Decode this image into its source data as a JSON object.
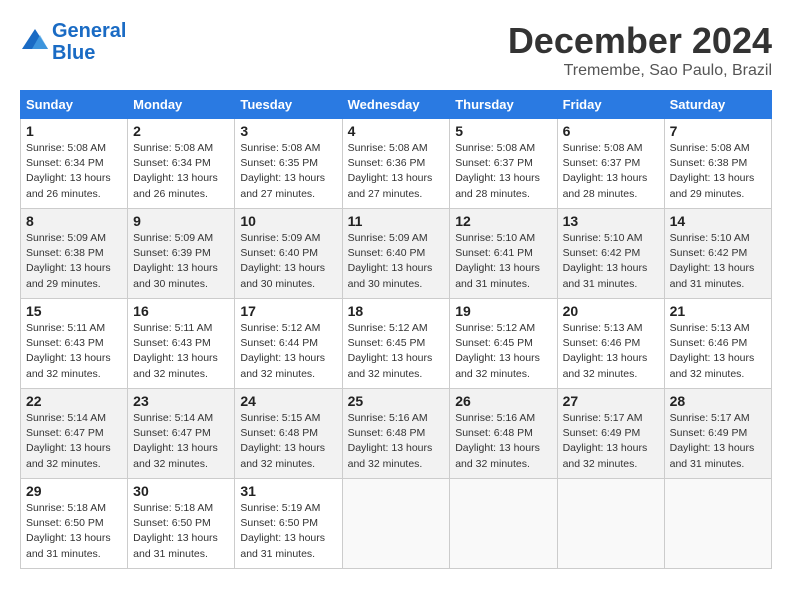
{
  "header": {
    "logo_line1": "General",
    "logo_line2": "Blue",
    "month": "December 2024",
    "location": "Tremembe, Sao Paulo, Brazil"
  },
  "weekdays": [
    "Sunday",
    "Monday",
    "Tuesday",
    "Wednesday",
    "Thursday",
    "Friday",
    "Saturday"
  ],
  "weeks": [
    [
      {
        "day": "1",
        "info": "Sunrise: 5:08 AM\nSunset: 6:34 PM\nDaylight: 13 hours\nand 26 minutes."
      },
      {
        "day": "2",
        "info": "Sunrise: 5:08 AM\nSunset: 6:34 PM\nDaylight: 13 hours\nand 26 minutes."
      },
      {
        "day": "3",
        "info": "Sunrise: 5:08 AM\nSunset: 6:35 PM\nDaylight: 13 hours\nand 27 minutes."
      },
      {
        "day": "4",
        "info": "Sunrise: 5:08 AM\nSunset: 6:36 PM\nDaylight: 13 hours\nand 27 minutes."
      },
      {
        "day": "5",
        "info": "Sunrise: 5:08 AM\nSunset: 6:37 PM\nDaylight: 13 hours\nand 28 minutes."
      },
      {
        "day": "6",
        "info": "Sunrise: 5:08 AM\nSunset: 6:37 PM\nDaylight: 13 hours\nand 28 minutes."
      },
      {
        "day": "7",
        "info": "Sunrise: 5:08 AM\nSunset: 6:38 PM\nDaylight: 13 hours\nand 29 minutes."
      }
    ],
    [
      {
        "day": "8",
        "info": "Sunrise: 5:09 AM\nSunset: 6:38 PM\nDaylight: 13 hours\nand 29 minutes."
      },
      {
        "day": "9",
        "info": "Sunrise: 5:09 AM\nSunset: 6:39 PM\nDaylight: 13 hours\nand 30 minutes."
      },
      {
        "day": "10",
        "info": "Sunrise: 5:09 AM\nSunset: 6:40 PM\nDaylight: 13 hours\nand 30 minutes."
      },
      {
        "day": "11",
        "info": "Sunrise: 5:09 AM\nSunset: 6:40 PM\nDaylight: 13 hours\nand 30 minutes."
      },
      {
        "day": "12",
        "info": "Sunrise: 5:10 AM\nSunset: 6:41 PM\nDaylight: 13 hours\nand 31 minutes."
      },
      {
        "day": "13",
        "info": "Sunrise: 5:10 AM\nSunset: 6:42 PM\nDaylight: 13 hours\nand 31 minutes."
      },
      {
        "day": "14",
        "info": "Sunrise: 5:10 AM\nSunset: 6:42 PM\nDaylight: 13 hours\nand 31 minutes."
      }
    ],
    [
      {
        "day": "15",
        "info": "Sunrise: 5:11 AM\nSunset: 6:43 PM\nDaylight: 13 hours\nand 32 minutes."
      },
      {
        "day": "16",
        "info": "Sunrise: 5:11 AM\nSunset: 6:43 PM\nDaylight: 13 hours\nand 32 minutes."
      },
      {
        "day": "17",
        "info": "Sunrise: 5:12 AM\nSunset: 6:44 PM\nDaylight: 13 hours\nand 32 minutes."
      },
      {
        "day": "18",
        "info": "Sunrise: 5:12 AM\nSunset: 6:45 PM\nDaylight: 13 hours\nand 32 minutes."
      },
      {
        "day": "19",
        "info": "Sunrise: 5:12 AM\nSunset: 6:45 PM\nDaylight: 13 hours\nand 32 minutes."
      },
      {
        "day": "20",
        "info": "Sunrise: 5:13 AM\nSunset: 6:46 PM\nDaylight: 13 hours\nand 32 minutes."
      },
      {
        "day": "21",
        "info": "Sunrise: 5:13 AM\nSunset: 6:46 PM\nDaylight: 13 hours\nand 32 minutes."
      }
    ],
    [
      {
        "day": "22",
        "info": "Sunrise: 5:14 AM\nSunset: 6:47 PM\nDaylight: 13 hours\nand 32 minutes."
      },
      {
        "day": "23",
        "info": "Sunrise: 5:14 AM\nSunset: 6:47 PM\nDaylight: 13 hours\nand 32 minutes."
      },
      {
        "day": "24",
        "info": "Sunrise: 5:15 AM\nSunset: 6:48 PM\nDaylight: 13 hours\nand 32 minutes."
      },
      {
        "day": "25",
        "info": "Sunrise: 5:16 AM\nSunset: 6:48 PM\nDaylight: 13 hours\nand 32 minutes."
      },
      {
        "day": "26",
        "info": "Sunrise: 5:16 AM\nSunset: 6:48 PM\nDaylight: 13 hours\nand 32 minutes."
      },
      {
        "day": "27",
        "info": "Sunrise: 5:17 AM\nSunset: 6:49 PM\nDaylight: 13 hours\nand 32 minutes."
      },
      {
        "day": "28",
        "info": "Sunrise: 5:17 AM\nSunset: 6:49 PM\nDaylight: 13 hours\nand 31 minutes."
      }
    ],
    [
      {
        "day": "29",
        "info": "Sunrise: 5:18 AM\nSunset: 6:50 PM\nDaylight: 13 hours\nand 31 minutes."
      },
      {
        "day": "30",
        "info": "Sunrise: 5:18 AM\nSunset: 6:50 PM\nDaylight: 13 hours\nand 31 minutes."
      },
      {
        "day": "31",
        "info": "Sunrise: 5:19 AM\nSunset: 6:50 PM\nDaylight: 13 hours\nand 31 minutes."
      },
      {
        "day": "",
        "info": ""
      },
      {
        "day": "",
        "info": ""
      },
      {
        "day": "",
        "info": ""
      },
      {
        "day": "",
        "info": ""
      }
    ]
  ]
}
